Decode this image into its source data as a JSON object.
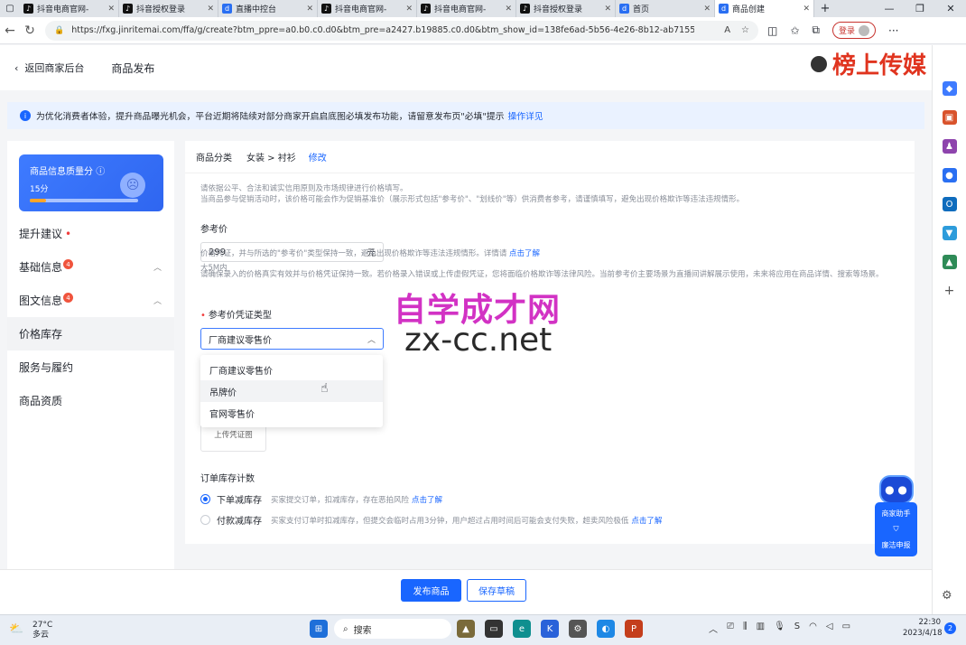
{
  "browser": {
    "tabs": [
      {
        "title": "抖音电商官网-",
        "icon": "douyin"
      },
      {
        "title": "抖音授权登录",
        "icon": "douyin"
      },
      {
        "title": "直播中控台",
        "icon": "doudian"
      },
      {
        "title": "抖音电商官网-",
        "icon": "douyin"
      },
      {
        "title": "抖音电商官网-",
        "icon": "douyin"
      },
      {
        "title": "抖音授权登录",
        "icon": "douyin"
      },
      {
        "title": "首页",
        "icon": "doudian"
      },
      {
        "title": "商品创建",
        "icon": "doudian",
        "active": true
      }
    ],
    "url": "https://fxg.jinritemai.com/ffa/g/create?btm_ppre=a0.b0.c0.d0&btm_pre=a2427.b19885.c0.d0&btm_show_id=138fe6ad-5b56-4e26-8b12-ab71558faac8",
    "login_label": "登录"
  },
  "header": {
    "back_label": "返回商家后台",
    "title": "商品发布"
  },
  "brand_watermark": "榜上传媒",
  "notice": {
    "text": "为优化消费者体验，提升商品曝光机会，平台近期将陆续对部分商家开启启底图必填发布功能，请留意发布页\"必填\"提示",
    "link": "操作详见"
  },
  "quality": {
    "label": "商品信息质量分",
    "score": "15分",
    "progress": 0.15
  },
  "nav": {
    "suggest": "提升建议",
    "items": [
      {
        "label": "基础信息",
        "badge": "4"
      },
      {
        "label": "图文信息",
        "badge": "4"
      },
      {
        "label": "价格库存"
      },
      {
        "label": "服务与履约"
      },
      {
        "label": "商品资质"
      }
    ]
  },
  "category": {
    "label": "商品分类",
    "value": "女装 > 衬衫",
    "edit": "修改"
  },
  "help_top": [
    "请依据公平、合法和诚实信用原则及市场规律进行价格填写。",
    "当商品参与促销活动时，该价格可能会作为促销基准价（展示形式包括\"参考价\"、\"划线价\"等）供消费者参考，请谨慎填写，避免出现价格欺诈等违法违规情形。"
  ],
  "ref_price": {
    "label": "参考价",
    "value": "299",
    "unit": "元"
  },
  "help_mid": "请确保录入的价格真实有效并与价格凭证保持一致。若价格录入错误或上传虚假凭证，您将面临价格欺诈等法律风险。当前参考价主要场景为直播间讲解展示使用，未来将应用在商品详情、搜索等场景。",
  "voucher": {
    "label": "参考价凭证类型",
    "selected": "厂商建议零售价",
    "options": [
      "厂商建议零售价",
      "吊牌价",
      "官网零售价"
    ]
  },
  "voucher_help": {
    "text": "价格凭证，并与所选的\"参考价\"类型保持一致，避免出现价格欺诈等违法违规情形。详情请",
    "link": "点击了解",
    "size": "大5M内"
  },
  "upload_label": "上传凭证图",
  "stock": {
    "label": "订单库存计数",
    "options": [
      {
        "label": "下单减库存",
        "desc": "买家提交订单，扣减库存，存在恶拍风险",
        "link": "点击了解",
        "checked": true
      },
      {
        "label": "付款减库存",
        "desc": "买家支付订单时扣减库存，但提交会临时占用3分钟，用户超过占用时间后可能会支付失败，超卖风险极低",
        "link": "点击了解",
        "checked": false
      }
    ]
  },
  "footer": {
    "publish": "发布商品",
    "draft": "保存草稿"
  },
  "assistant": {
    "label": "商家助手",
    "report": "廉洁申报"
  },
  "watermark": {
    "cn": "自学成才网",
    "url": "zx-cc.net"
  },
  "taskbar": {
    "temp": "27°C",
    "weather": "多云",
    "search": "搜索",
    "time": "22:30",
    "date": "2023/4/18",
    "notifications": "2"
  }
}
